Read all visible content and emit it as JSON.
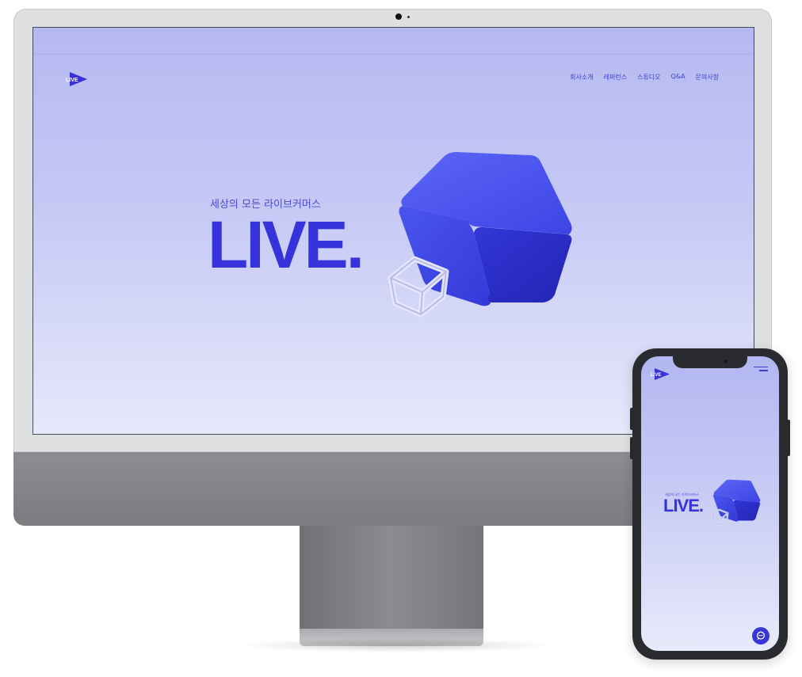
{
  "desktop": {
    "logo_text": "LIVE",
    "nav": [
      "회사소개",
      "레퍼런스",
      "스튜디오",
      "Q&A",
      "문의사항"
    ],
    "hero": {
      "subtitle": "세상의 모든 라이브커머스",
      "headline": "LIVE."
    }
  },
  "mobile": {
    "logo_text": "LIVE",
    "hero": {
      "subtitle": "세상의 모든 라이브커머스",
      "headline": "LIVE."
    }
  },
  "colors": {
    "brand": "#3633db",
    "cube_light": "#4f59f0",
    "cube_dark": "#2a2bc4",
    "background_top": "#b5b9f1",
    "background_bottom": "#e6e8fb"
  },
  "icons": {
    "logo": "play-triangle-icon",
    "menu": "hamburger-menu-icon",
    "chat": "chat-bubble-icon"
  }
}
